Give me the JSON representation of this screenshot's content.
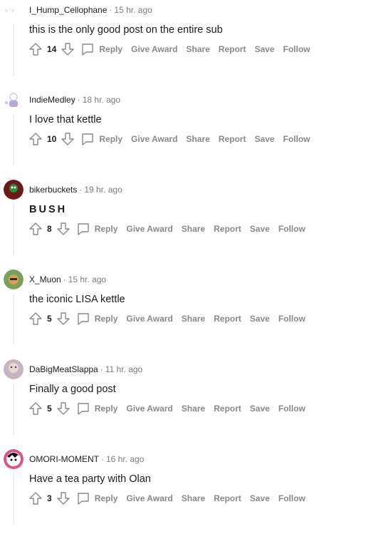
{
  "actions": {
    "reply": "Reply",
    "give_award": "Give Award",
    "share": "Share",
    "report": "Report",
    "save": "Save",
    "follow": "Follow"
  },
  "comments": [
    {
      "user": "I_Hump_Cellophane",
      "time": "15 hr. ago",
      "text": "this is the only good post on the entire sub",
      "score": "14"
    },
    {
      "user": "IndieMedley",
      "time": "18 hr. ago",
      "text": "I love that kettle",
      "score": "10"
    },
    {
      "user": "bikerbuckets",
      "time": "19 hr. ago",
      "text": "BUSH",
      "score": "8"
    },
    {
      "user": "X_Muon",
      "time": "15 hr. ago",
      "text": "the iconic LISA kettle",
      "score": "5"
    },
    {
      "user": "DaBigMeatSlappa",
      "time": "11 hr. ago",
      "text": "Finally a good post",
      "score": "5"
    },
    {
      "user": "OMORI-MOMENT",
      "time": "16 hr. ago",
      "text": "Have a tea party with Olan",
      "score": "3"
    }
  ],
  "colors": {
    "meta": "#7c7c7c",
    "action": "#878a8c",
    "text": "#1c1c1c",
    "thread_line": "#edeff1"
  }
}
